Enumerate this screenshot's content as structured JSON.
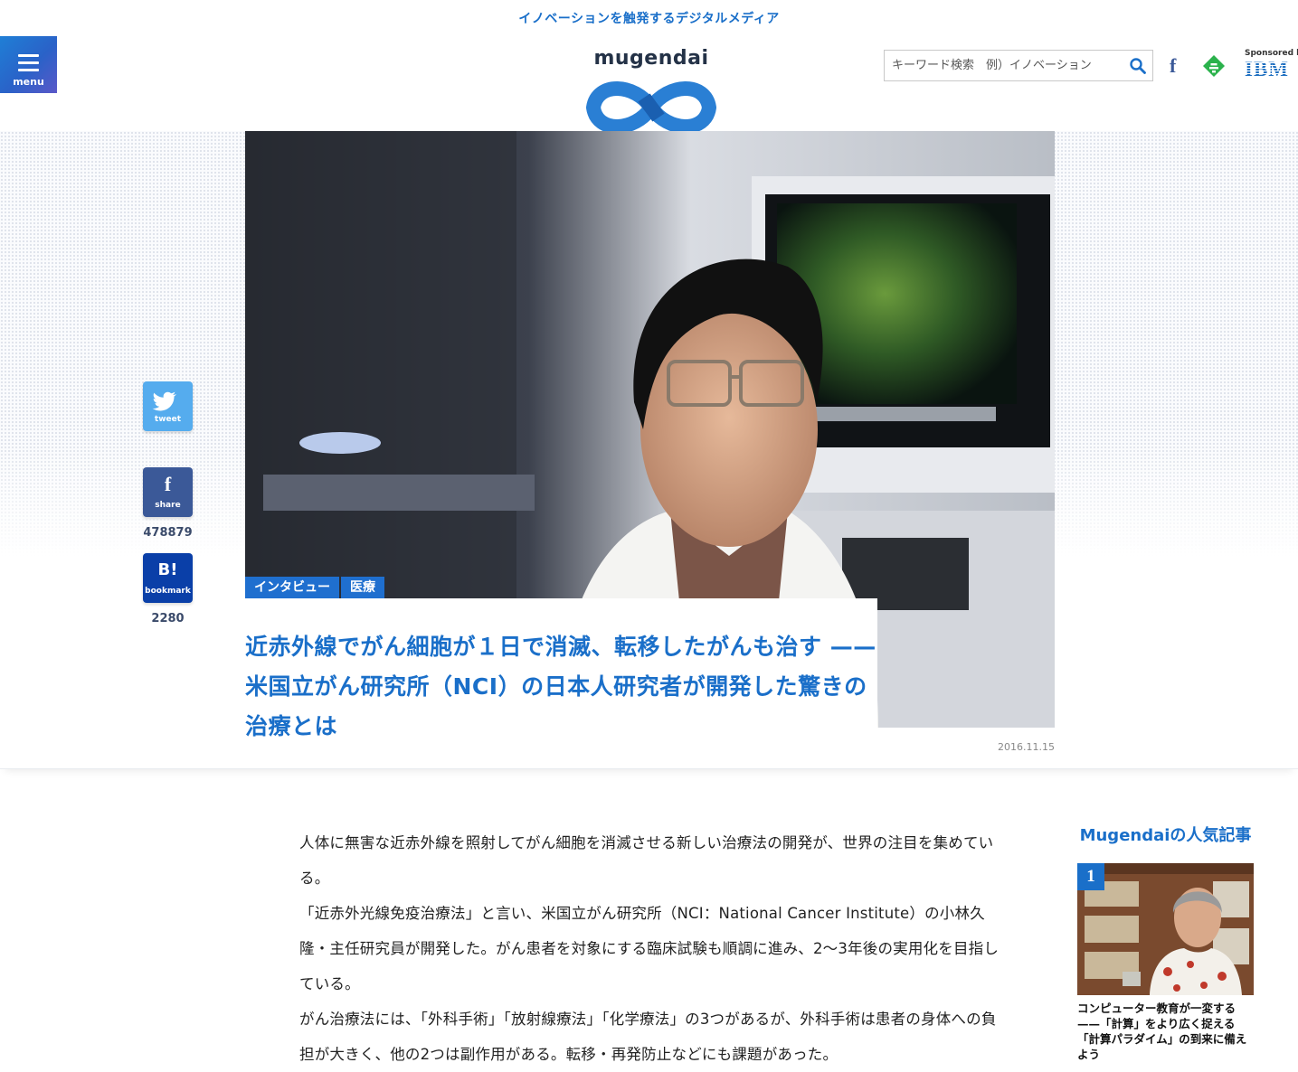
{
  "header": {
    "tagline": "イノベーションを触発するデジタルメディア",
    "menu_label": "menu",
    "logo_text": "mugendai",
    "search_placeholder": "キーワード検索　例）イノベーション",
    "facebook_glyph": "f",
    "sponsored_by": "Sponsored by",
    "sponsor_name": "IBM"
  },
  "article": {
    "categories": [
      "インタビュー",
      "医療"
    ],
    "title": "近赤外線でがん細胞が１日で消滅、転移したがんも治す ——米国立がん研究所（NCI）の日本人研究者が開発した驚きの治療とは",
    "date": "2016.11.15",
    "paragraphs": [
      "人体に無害な近赤外線を照射してがん細胞を消滅させる新しい治療法の開発が、世界の注目を集めている。",
      "「近赤外光線免疫治療法」と言い、米国立がん研究所（NCI：National Cancer Institute）の小林久隆・主任研究員が開発した。がん患者を対象にする臨床試験も順調に進み、2〜3年後の実用化を目指している。",
      "がん治療法には、「外科手術」「放射線療法」「化学療法」の3つがあるが、外科手術は患者の身体への負担が大きく、他の2つは副作用がある。転移・再発防止などにも課題があった。"
    ]
  },
  "share": {
    "tweet_label": "tweet",
    "fb_label": "share",
    "fb_count": "478879",
    "hatena_glyph": "B!",
    "hatena_label": "bookmark",
    "hatena_count": "2280"
  },
  "sidebar": {
    "title": "Mugendaiの人気記事",
    "ranking": [
      {
        "rank": "1",
        "caption": "コンピューター教育が一変する——「計算」をより広く捉える「計算パラダイム」の到来に備えよう"
      }
    ]
  },
  "colors": {
    "accent": "#1a6fc9",
    "twitter": "#55acee",
    "facebook": "#3b5998",
    "hatena": "#0a3fa8"
  },
  "icons": [
    "menu-icon",
    "search-icon",
    "facebook-icon",
    "feedly-icon",
    "twitter-icon",
    "hatena-icon"
  ]
}
